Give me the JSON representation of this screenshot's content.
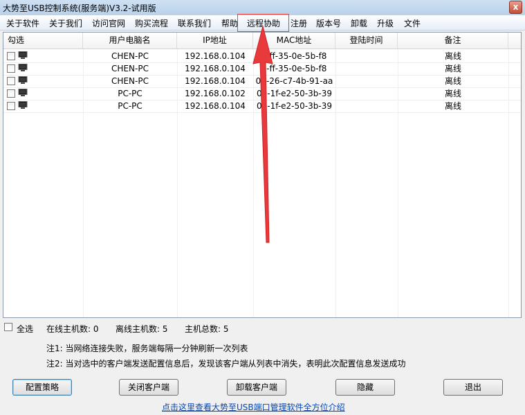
{
  "window": {
    "title": "大势至USB控制系统(服务端)V3.2-试用版",
    "close_glyph": "x"
  },
  "menu": [
    {
      "label": "关于软件"
    },
    {
      "label": "关于我们"
    },
    {
      "label": "访问官网"
    },
    {
      "label": "购买流程"
    },
    {
      "label": "联系我们"
    },
    {
      "label": "帮助"
    },
    {
      "label": "远程协助"
    },
    {
      "label": "注册"
    },
    {
      "label": "版本号"
    },
    {
      "label": "卸载"
    },
    {
      "label": "升级"
    },
    {
      "label": "文件"
    }
  ],
  "table": {
    "columns": [
      "勾选",
      "用户电脑名",
      "IP地址",
      "MAC地址",
      "登陆时间",
      "备注"
    ],
    "rows": [
      {
        "name": "CHEN-PC",
        "ip": "192.168.0.104",
        "mac": "c-ff-35-0e-5b-f8",
        "login": "",
        "note": "离线"
      },
      {
        "name": "CHEN-PC",
        "ip": "192.168.0.104",
        "mac": "c-ff-35-0e-5b-f8",
        "login": "",
        "note": "离线"
      },
      {
        "name": "CHEN-PC",
        "ip": "192.168.0.104",
        "mac": "00-26-c7-4b-91-aa",
        "login": "",
        "note": "离线"
      },
      {
        "name": "PC-PC",
        "ip": "192.168.0.102",
        "mac": "00-1f-e2-50-3b-39",
        "login": "",
        "note": "离线"
      },
      {
        "name": "PC-PC",
        "ip": "192.168.0.104",
        "mac": "00-1f-e2-50-3b-39",
        "login": "",
        "note": "离线"
      }
    ]
  },
  "status": {
    "select_all": "全选",
    "online": "在线主机数: 0",
    "offline": "离线主机数: 5",
    "total": "主机总数: 5"
  },
  "notes": [
    "注1: 当网络连接失败，服务端每隔一分钟刷新一次列表",
    "注2: 当对选中的客户端发送配置信息后，发现该客户端从列表中消失，表明此次配置信息发送成功"
  ],
  "buttons": {
    "config": "配置策略",
    "close_client": "关闭客户端",
    "uninstall_client": "卸载客户端",
    "hide": "隐藏",
    "exit": "退出"
  },
  "link": "点击这里查看大势至USB端口管理软件全方位介绍",
  "colors": {
    "highlight": "#e64545",
    "arrow": "#e8393c",
    "link": "#0645ad"
  }
}
